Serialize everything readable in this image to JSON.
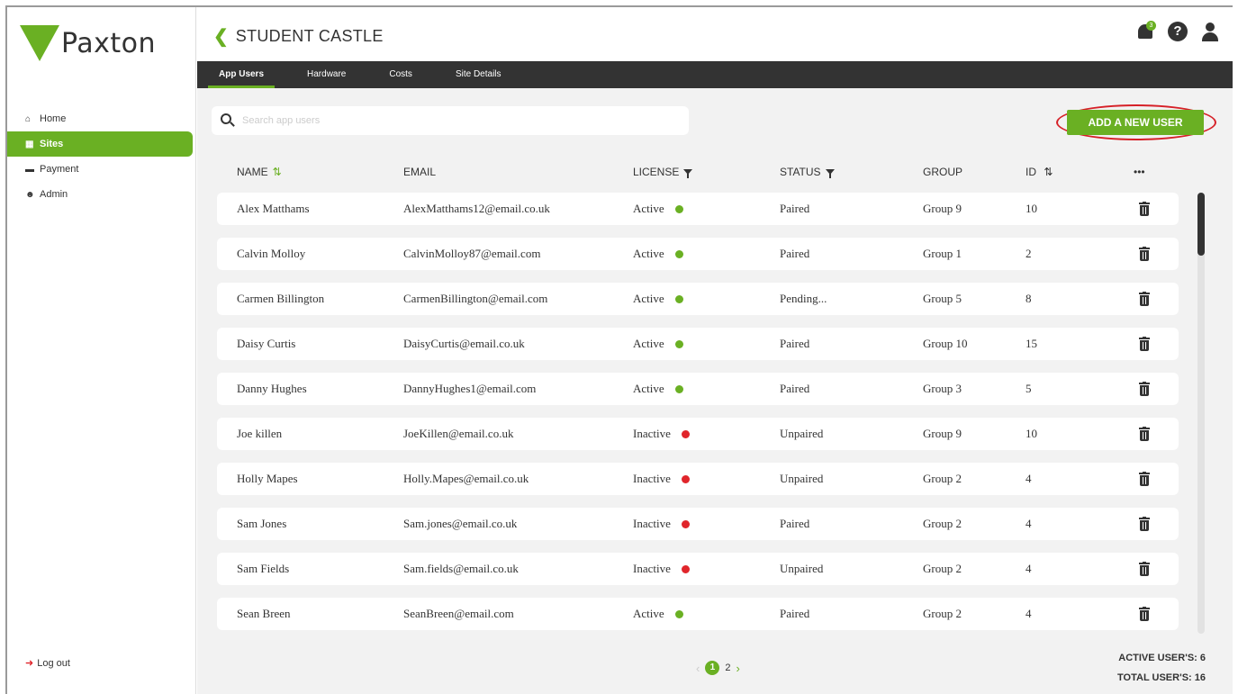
{
  "brand": {
    "name": "Paxton",
    "accent": "#6ab023",
    "dark": "#333333",
    "alert": "#e0252b"
  },
  "sidebar": {
    "items": [
      {
        "icon": "home-icon",
        "label": "Home",
        "active": false
      },
      {
        "icon": "sites-icon",
        "label": "Sites",
        "active": true
      },
      {
        "icon": "payment-icon",
        "label": "Payment",
        "active": false
      },
      {
        "icon": "admin-icon",
        "label": "Admin",
        "active": false
      }
    ],
    "logout_label": "Log out"
  },
  "header": {
    "title": "STUDENT CASTLE",
    "notification_badge": "3"
  },
  "tabs": [
    {
      "label": "App Users",
      "active": true
    },
    {
      "label": "Hardware",
      "active": false
    },
    {
      "label": "Costs",
      "active": false
    },
    {
      "label": "Site Details",
      "active": false
    }
  ],
  "search": {
    "placeholder": "Search app users",
    "value": ""
  },
  "add_button_label": "ADD A NEW USER",
  "table": {
    "columns": {
      "name": "NAME",
      "email": "EMAIL",
      "license": "LICENSE",
      "status": "STATUS",
      "group": "GROUP",
      "id": "ID",
      "more": "•••"
    },
    "rows": [
      {
        "name": "Alex Matthams",
        "email": "AlexMatthams12@email.co.uk",
        "license": "Active",
        "status": "Paired",
        "group": "Group 9",
        "id": "10"
      },
      {
        "name": "Calvin Molloy",
        "email": "CalvinMolloy87@email.com",
        "license": "Active",
        "status": "Paired",
        "group": "Group 1",
        "id": "2"
      },
      {
        "name": "Carmen Billington",
        "email": "CarmenBillington@email.com",
        "license": "Active",
        "status": "Pending...",
        "group": "Group 5",
        "id": "8"
      },
      {
        "name": "Daisy Curtis",
        "email": "DaisyCurtis@email.co.uk",
        "license": "Active",
        "status": "Paired",
        "group": "Group 10",
        "id": "15"
      },
      {
        "name": "Danny Hughes",
        "email": "DannyHughes1@email.com",
        "license": "Active",
        "status": "Paired",
        "group": "Group 3",
        "id": "5"
      },
      {
        "name": "Joe killen",
        "email": "JoeKillen@email.co.uk",
        "license": "Inactive",
        "status": "Unpaired",
        "group": "Group 9",
        "id": "10"
      },
      {
        "name": "Holly Mapes",
        "email": "Holly.Mapes@email.co.uk",
        "license": "Inactive",
        "status": "Unpaired",
        "group": "Group 2",
        "id": "4"
      },
      {
        "name": "Sam Jones",
        "email": "Sam.jones@email.co.uk",
        "license": "Inactive",
        "status": "Paired",
        "group": "Group 2",
        "id": "4"
      },
      {
        "name": "Sam Fields",
        "email": "Sam.fields@email.co.uk",
        "license": "Inactive",
        "status": "Unpaired",
        "group": "Group 2",
        "id": "4"
      },
      {
        "name": "Sean Breen",
        "email": "SeanBreen@email.com",
        "license": "Active",
        "status": "Paired",
        "group": "Group 2",
        "id": "4"
      }
    ]
  },
  "pagination": {
    "current": "1",
    "next": "2",
    "prev_arrow": "‹",
    "next_arrow": "›"
  },
  "totals": {
    "active": "ACTIVE USER'S: 6",
    "total": "TOTAL USER'S: 16"
  }
}
